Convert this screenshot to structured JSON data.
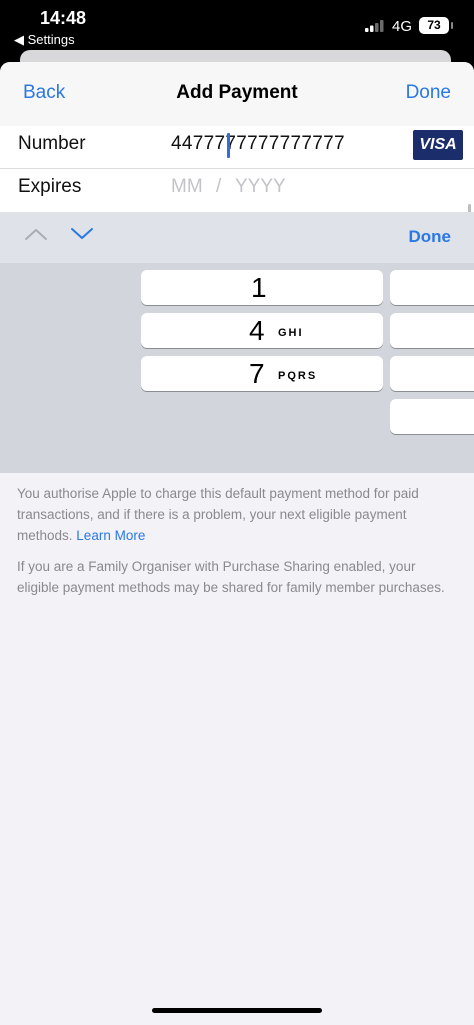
{
  "status_bar": {
    "time": "14:48",
    "back_app": "◀ Settings",
    "network": "4G",
    "battery": "73"
  },
  "nav": {
    "back": "Back",
    "title": "Add Payment",
    "done": "Done"
  },
  "form": {
    "number_label": "Number",
    "number_value": "4477777777777777",
    "card_brand": "VISA",
    "expires_label": "Expires",
    "expires_month_placeholder": "MM",
    "expires_separator": "/",
    "expires_year_placeholder": "YYYY"
  },
  "toolbar": {
    "done": "Done"
  },
  "keyboard": {
    "keys": [
      {
        "number": "1",
        "letters": ""
      },
      {
        "number": "4",
        "letters": "GHI"
      },
      {
        "number": "7",
        "letters": "PQRS"
      }
    ]
  },
  "footer": {
    "paragraph1": "You authorise Apple to charge this default payment method for paid transactions, and if there is a problem, your next eligible payment methods.",
    "learn_more": "Learn More",
    "paragraph2": "If you are a Family Organiser with Purchase Sharing enabled, your eligible payment methods may be shared for family member purchases."
  },
  "colors": {
    "accent": "#2a78e4",
    "visa_bg": "#1c2d6b",
    "sheet_bg": "#f2f2f7",
    "keyboard_bg": "#d2d5db"
  }
}
